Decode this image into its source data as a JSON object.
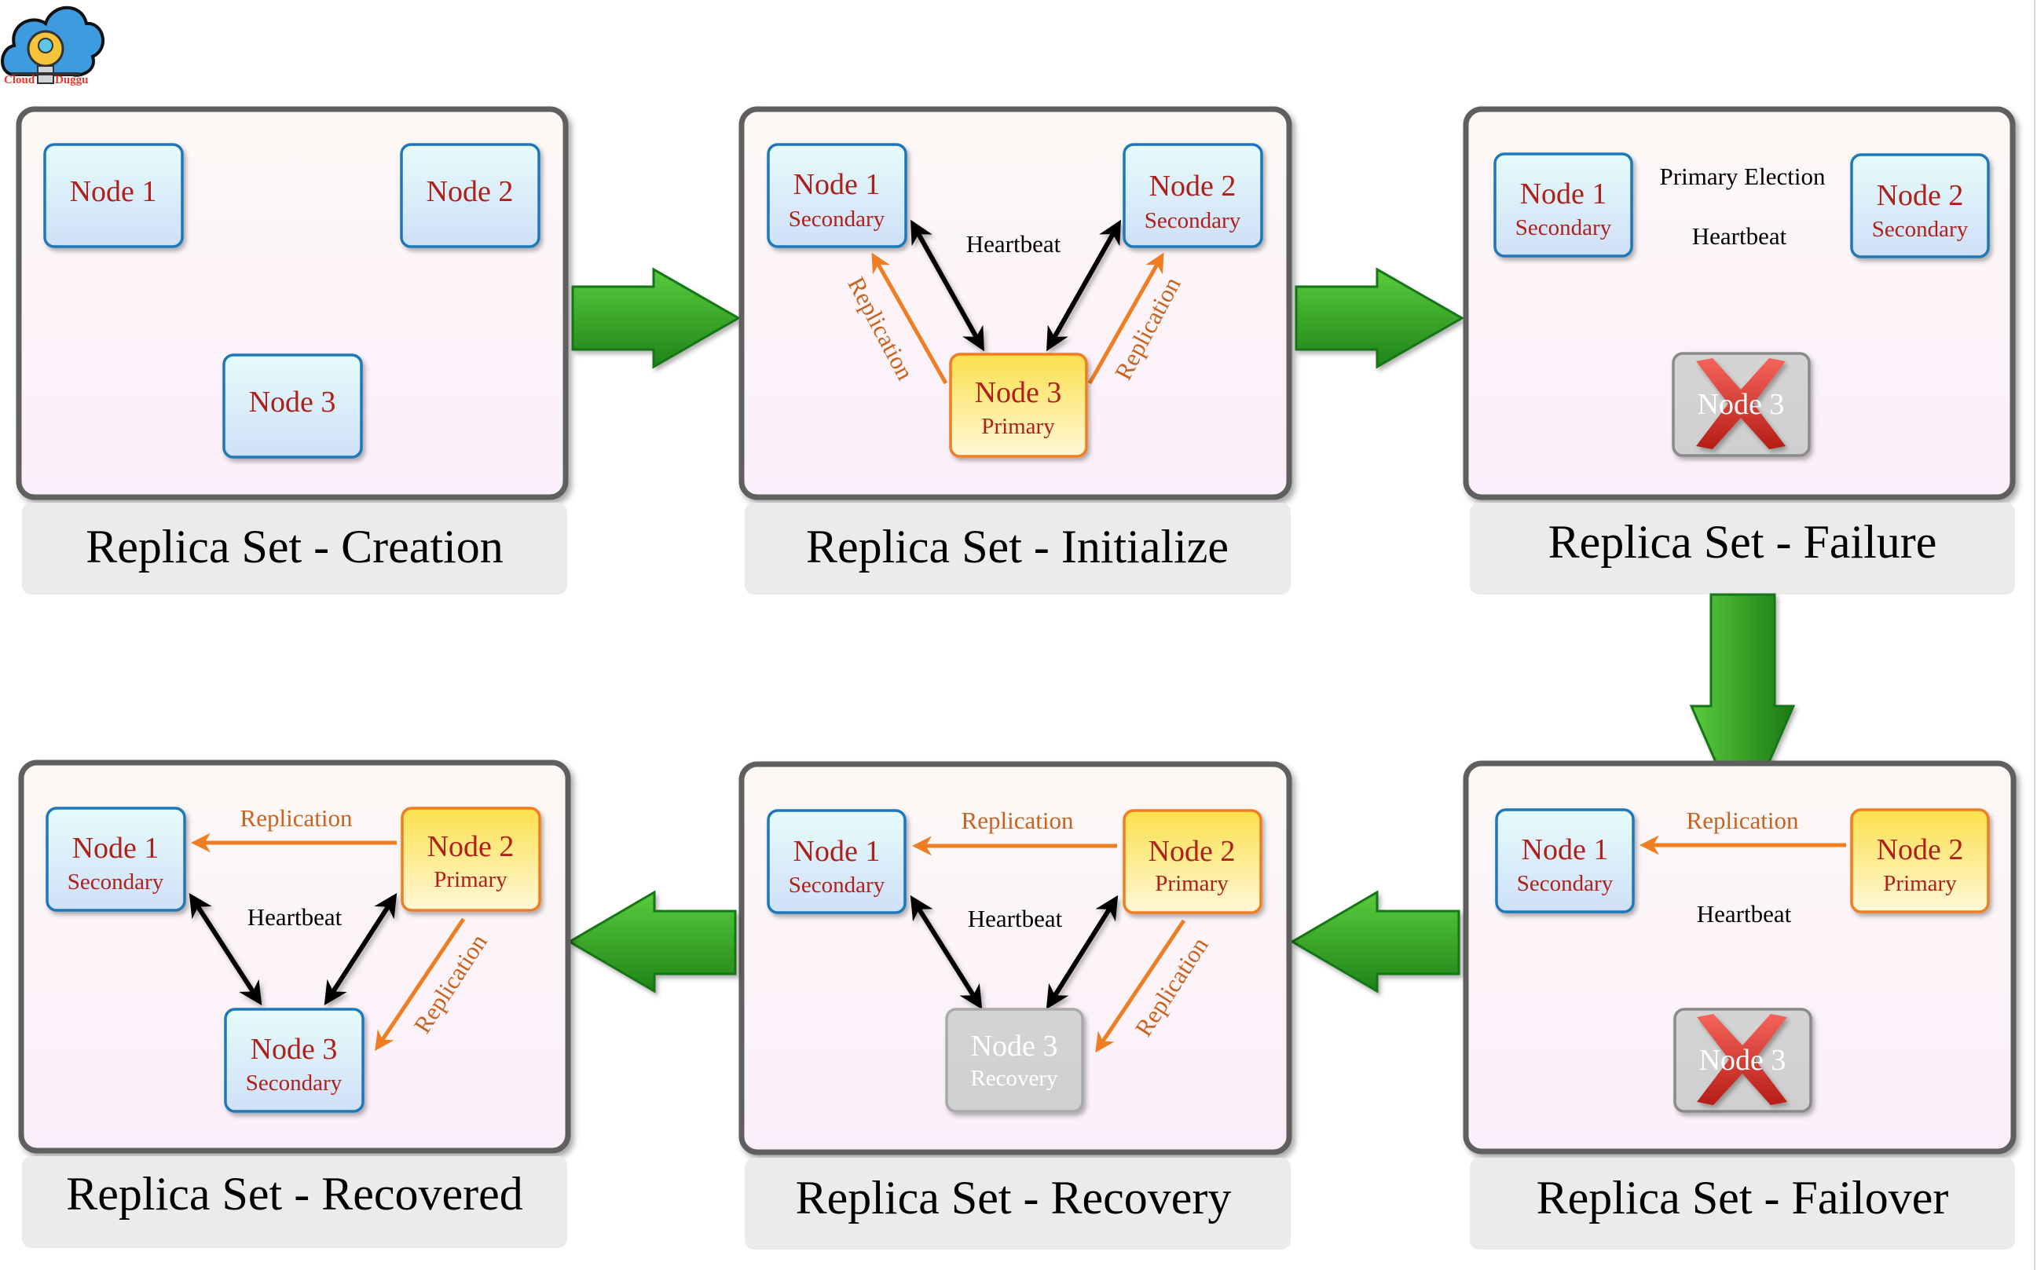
{
  "logo": {
    "left_text": "Cloud",
    "right_text": "Duggu",
    "icon": "cloud-lightbulb-icon"
  },
  "colors": {
    "panel_border": "#5f5f5f",
    "caption_bg": "#ebebeb",
    "secondary_border": "#1f78b8",
    "primary_border": "#ef7d22",
    "down_fill": "#d2d2d2",
    "node_text": "#b0201a",
    "replication": "#ef7d22",
    "replication_text": "#c8621d",
    "flow_arrow": "#2e9e2a",
    "fail_cross": "#d83a2c"
  },
  "panels": [
    {
      "id": "creation",
      "caption": "Replica Set - Creation",
      "nodes": [
        {
          "title": "Node 1",
          "role": "",
          "state": "new"
        },
        {
          "title": "Node 2",
          "role": "",
          "state": "new"
        },
        {
          "title": "Node 3",
          "role": "",
          "state": "new"
        }
      ],
      "labels": []
    },
    {
      "id": "initialize",
      "caption": "Replica Set - Initialize",
      "nodes": [
        {
          "title": "Node 1",
          "role": "Secondary",
          "state": "secondary"
        },
        {
          "title": "Node 2",
          "role": "Secondary",
          "state": "secondary"
        },
        {
          "title": "Node 3",
          "role": "Primary",
          "state": "primary"
        }
      ],
      "labels": {
        "heartbeat": "Heartbeat",
        "replication_left": "Replication",
        "replication_right": "Replication"
      }
    },
    {
      "id": "failure",
      "caption": "Replica Set - Failure",
      "nodes": [
        {
          "title": "Node 1",
          "role": "Secondary",
          "state": "secondary"
        },
        {
          "title": "Node 2",
          "role": "Secondary",
          "state": "secondary"
        },
        {
          "title": "Node 3",
          "role": "",
          "state": "failed"
        }
      ],
      "labels": {
        "election": "Primary Election",
        "heartbeat": "Heartbeat"
      }
    },
    {
      "id": "failover",
      "caption": "Replica Set - Failover",
      "nodes": [
        {
          "title": "Node 1",
          "role": "Secondary",
          "state": "secondary"
        },
        {
          "title": "Node 2",
          "role": "Primary",
          "state": "primary"
        },
        {
          "title": "Node 3",
          "role": "",
          "state": "failed"
        }
      ],
      "labels": {
        "replication": "Replication",
        "heartbeat": "Heartbeat"
      }
    },
    {
      "id": "recovery",
      "caption": "Replica Set - Recovery",
      "nodes": [
        {
          "title": "Node 1",
          "role": "Secondary",
          "state": "secondary"
        },
        {
          "title": "Node 2",
          "role": "Primary",
          "state": "primary"
        },
        {
          "title": "Node 3",
          "role": "Recovery",
          "state": "recovering"
        }
      ],
      "labels": {
        "replication_top": "Replication",
        "heartbeat": "Heartbeat",
        "replication_diag": "Replication"
      }
    },
    {
      "id": "recovered",
      "caption": "Replica Set - Recovered",
      "nodes": [
        {
          "title": "Node 1",
          "role": "Secondary",
          "state": "secondary"
        },
        {
          "title": "Node 2",
          "role": "Primary",
          "state": "primary"
        },
        {
          "title": "Node 3",
          "role": "Secondary",
          "state": "secondary"
        }
      ],
      "labels": {
        "replication_top": "Replication",
        "heartbeat": "Heartbeat",
        "replication_diag": "Replication"
      }
    }
  ],
  "flow": [
    "creation",
    "initialize",
    "failure",
    "failover",
    "recovery",
    "recovered"
  ]
}
